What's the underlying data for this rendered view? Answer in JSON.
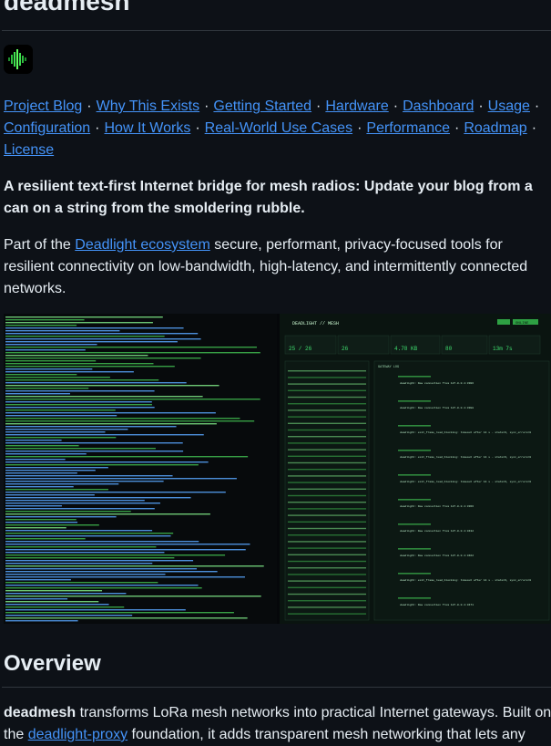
{
  "header": {
    "title": "deadmesh"
  },
  "nav": {
    "links": [
      "Project Blog",
      "Why This Exists",
      "Getting Started",
      "Hardware",
      "Dashboard",
      "Usage",
      "Configuration",
      "How It Works",
      "Real-World Use Cases",
      "Performance",
      "Roadmap",
      "License"
    ],
    "separator": "·"
  },
  "intro": {
    "tagline": "A resilient text-first Internet bridge for mesh radios: Update your blog from a can on a string from the smoldering rubble.",
    "para_prefix": "Part of the ",
    "ecosystem_link": "Deadlight ecosystem",
    "para_suffix": " secure, performant, privacy-focused tools for resilient connectivity on low-bandwidth, high-latency, and intermittently connected networks."
  },
  "screenshot": {
    "dashboard_title": "DEADLIGHT // MESH",
    "status_badge": "ONLINE",
    "stats": [
      {
        "value": "25 / 26"
      },
      {
        "value": "26"
      },
      {
        "value": "4.78 KB"
      },
      {
        "value": "80"
      },
      {
        "value": "13m 7s"
      }
    ],
    "gateway_log_title": "GATEWAY LOG",
    "gateway_entries": [
      "deadlight: New connection from 127.0.0.1:3306",
      "deadlight: New connection from 127.0.0.1:3388",
      "deadlight: exit_frame_read_blocking: timeout after 14 s - state=6, sync_errors=0",
      "deadlight: exit_frame_read_blocking: timeout after 14 s - state=6, sync_errors=0",
      "deadlight: exit_frame_read_blocking: timeout after 14 s - state=6, sync_errors=0",
      "deadlight: New connection from 127.0.0.1:3366",
      "deadlight: New connection from 127.0.0.1:3432",
      "deadlight: New connection from 127.0.0.1:3462",
      "deadlight: exit_frame_read_blocking: timeout after 14 s - state=6, sync_errors=0",
      "deadlight: New connection from 127.0.0.1:3471"
    ]
  },
  "overview": {
    "heading": "Overview",
    "bold_word": "deadmesh",
    "text_1": " transforms LoRa mesh networks into practical Internet gateways. Built on the ",
    "proxy_link": "deadlight-proxy",
    "text_2": " foundation, it adds transparent mesh networking that lets any"
  },
  "colors": {
    "link": "#4493f8",
    "bg": "#0d1117",
    "terminal_green": "#3fb950",
    "terminal_blue": "#58a6ff"
  }
}
